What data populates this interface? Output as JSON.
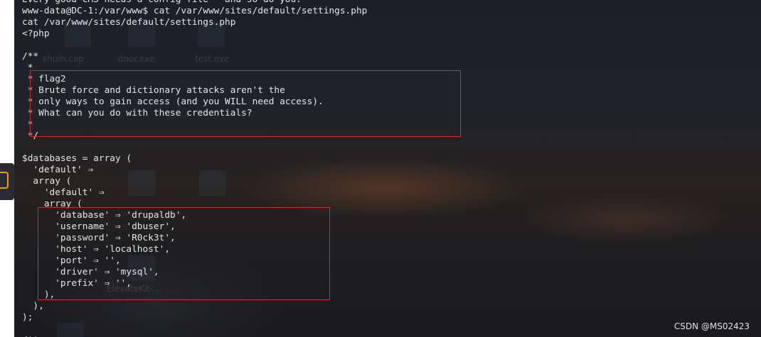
{
  "terminal": {
    "lines": [
      "Every good CMS needs a config file - and so do you.",
      "www-data@DC-1:/var/www$ cat /var/www/sites/default/settings.php",
      "cat /var/www/sites/default/settings.php",
      "<?php",
      "",
      "/**",
      " *",
      " * flag2",
      " * Brute force and dictionary attacks aren't the",
      " * only ways to gain access (and you WILL need access).",
      " * What can you do with these credentials?",
      " *",
      " */",
      "",
      "$databases = array (",
      "  'default' ⇒",
      "  array (",
      "    'default' ⇒",
      "    array (",
      "      'database' ⇒ 'drupaldb',",
      "      'username' ⇒ 'dbuser',",
      "      'password' ⇒ 'R0ck3t',",
      "      'host' ⇒ 'localhost',",
      "      'port' ⇒ '',",
      "      'driver' ⇒ 'mysql',",
      "      'prefix' ⇒ '',",
      "    ),",
      "  ),",
      ");",
      "",
      "/**"
    ]
  },
  "desktop_ghost": {
    "labels": [
      "shuin.cap",
      "door.exe",
      "test.exe",
      "ElevateKit-..."
    ]
  },
  "watermark": "CSDN @MS02423",
  "colors": {
    "terminal_text": "#e6e6e6",
    "highlight_border": "#c0313a",
    "side_tab_icon": "#e8a010"
  }
}
